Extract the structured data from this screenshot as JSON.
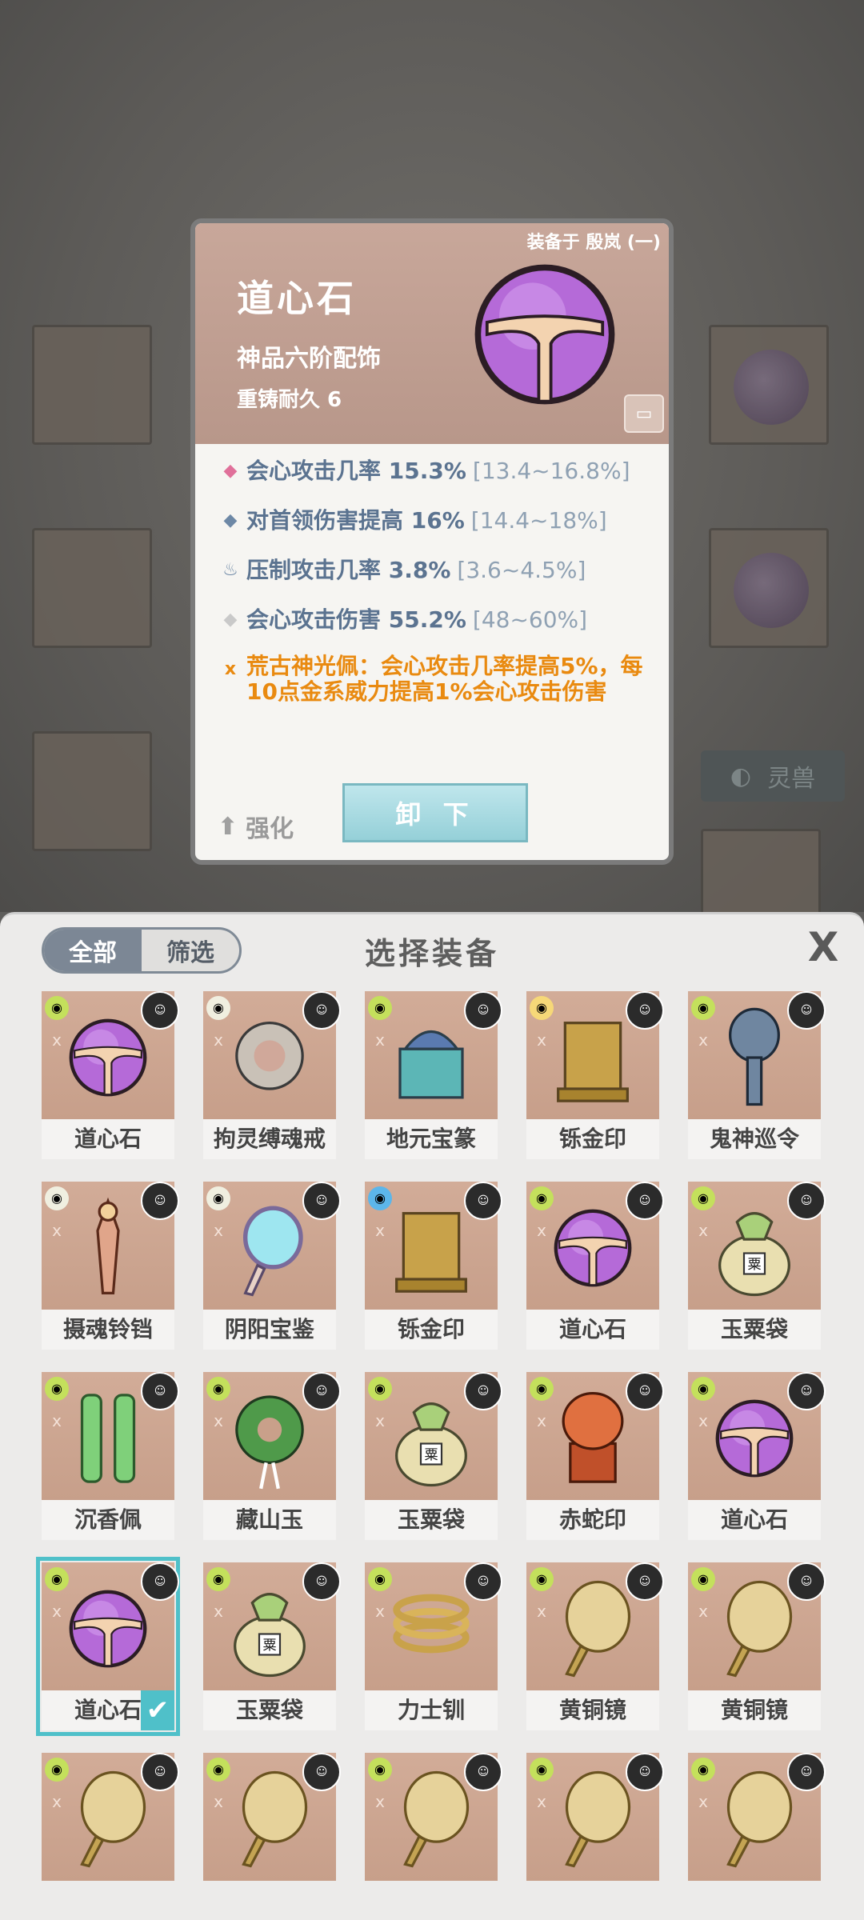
{
  "detail": {
    "equipped_by": "装备于 殷岚 (一)",
    "name": "道心石",
    "grade": "神品六阶配饰",
    "durability": "重铸耐久 6",
    "attributes": [
      {
        "icon": "pink-diamond-icon",
        "symbol": "◆",
        "color": "#e0709a",
        "text": "会心攻击几率 15.3%",
        "range": "[13.4~16.8%]"
      },
      {
        "icon": "blue-diamond-icon",
        "symbol": "◆",
        "color": "#6d88a6",
        "text": "对首领伤害提高 16%",
        "range": "[14.4~18%]"
      },
      {
        "icon": "flame-icon",
        "symbol": "♨",
        "color": "#6d88a6",
        "text": "压制攻击几率 3.8%",
        "range": "[3.6~4.5%]"
      },
      {
        "icon": "gray-diamond-icon",
        "symbol": "◆",
        "color": "#c9c9c9",
        "text": "会心攻击伤害 55.2%",
        "range": "[48~60%]"
      }
    ],
    "special": {
      "icon": "set-bonus-icon",
      "symbol": "ⅹ",
      "text": "荒古神光佩：会心攻击几率提高5%，每10点金系威力提高1%会心攻击伤害"
    },
    "enhance_label": "强化",
    "unequip_label": "卸 下"
  },
  "background": {
    "beast_label": "灵兽"
  },
  "panel": {
    "tabs": [
      "全部",
      "筛选"
    ],
    "title": "选择装备",
    "close_symbol": "X"
  },
  "items": [
    {
      "name": "道心石",
      "type": "orb",
      "element": "#c4e05c",
      "selected": false
    },
    {
      "name": "拘灵缚魂戒",
      "type": "ring",
      "element": "#f0efe0",
      "selected": false
    },
    {
      "name": "地元宝篆",
      "type": "box",
      "element": "#c4e05c",
      "selected": false
    },
    {
      "name": "铄金印",
      "type": "seal",
      "element": "#f6d878",
      "selected": false
    },
    {
      "name": "鬼神巡令",
      "type": "token",
      "element": "#c4e05c",
      "selected": false
    },
    {
      "name": "摄魂铃铛",
      "type": "bell",
      "element": "#f0efe0",
      "selected": false
    },
    {
      "name": "阴阳宝鉴",
      "type": "mirror",
      "element": "#f0efe0",
      "selected": false
    },
    {
      "name": "铄金印",
      "type": "seal",
      "element": "#5cb6ea",
      "selected": false
    },
    {
      "name": "道心石",
      "type": "orb",
      "element": "#c4e05c",
      "selected": false
    },
    {
      "name": "玉粟袋",
      "type": "bag",
      "element": "#c4e05c",
      "selected": false
    },
    {
      "name": "沉香佩",
      "type": "pendant",
      "element": "#c4e05c",
      "selected": false
    },
    {
      "name": "藏山玉",
      "type": "jade",
      "element": "#c4e05c",
      "selected": false
    },
    {
      "name": "玉粟袋",
      "type": "bag",
      "element": "#c4e05c",
      "selected": false
    },
    {
      "name": "赤蛇印",
      "type": "snakeseal",
      "element": "#c4e05c",
      "selected": false
    },
    {
      "name": "道心石",
      "type": "orb",
      "element": "#c4e05c",
      "selected": false
    },
    {
      "name": "道心石",
      "type": "orb",
      "element": "#c4e05c",
      "selected": true
    },
    {
      "name": "玉粟袋",
      "type": "bag",
      "element": "#c4e05c",
      "selected": false
    },
    {
      "name": "力士钏",
      "type": "bracelet",
      "element": "#c4e05c",
      "selected": false
    },
    {
      "name": "黄铜镜",
      "type": "brassmirror",
      "element": "#c4e05c",
      "selected": false
    },
    {
      "name": "黄铜镜",
      "type": "brassmirror",
      "element": "#c4e05c",
      "selected": false
    },
    {
      "name": "",
      "type": "brassmirror",
      "element": "#c4e05c",
      "selected": false
    },
    {
      "name": "",
      "type": "brassmirror",
      "element": "#c4e05c",
      "selected": false
    },
    {
      "name": "",
      "type": "brassmirror",
      "element": "#c4e05c",
      "selected": false
    },
    {
      "name": "",
      "type": "brassmirror",
      "element": "#c4e05c",
      "selected": false
    },
    {
      "name": "",
      "type": "brassmirror",
      "element": "#c4e05c",
      "selected": false
    }
  ]
}
